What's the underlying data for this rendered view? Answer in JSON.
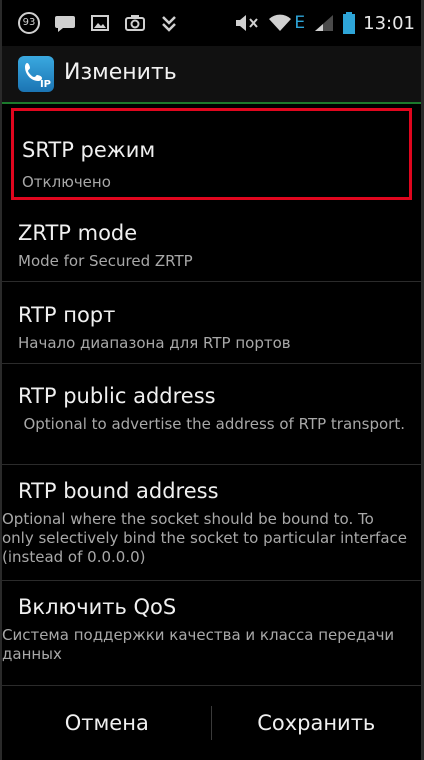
{
  "status_bar": {
    "notification_count": "93",
    "network_type": "E",
    "time": "13:01"
  },
  "action_bar": {
    "title": "Изменить",
    "app_icon_label": "IP"
  },
  "settings": [
    {
      "title": "SRTP режим",
      "subtitle": "Отключено"
    },
    {
      "title": "ZRTP mode",
      "subtitle": "Mode for Secured ZRTP"
    },
    {
      "title": "RTP порт",
      "subtitle": "Начало диапазона для RTP портов"
    },
    {
      "title": "RTP public address",
      "subtitle": "Optional to advertise the address of RTP transport."
    },
    {
      "title": "RTP bound address",
      "subtitle": "Optional where the socket should be bound to. To only selectively bind the socket to particular interface (instead of 0.0.0.0)"
    },
    {
      "title": "Включить QoS",
      "subtitle": "Система поддержки качества и класса передачи данных"
    }
  ],
  "footer": {
    "cancel_label": "Отмена",
    "save_label": "Сохранить"
  },
  "colors": {
    "highlight": "#e0061e",
    "actionbar_divider": "#1b7a2c",
    "network_accent": "#2ea5d8"
  }
}
